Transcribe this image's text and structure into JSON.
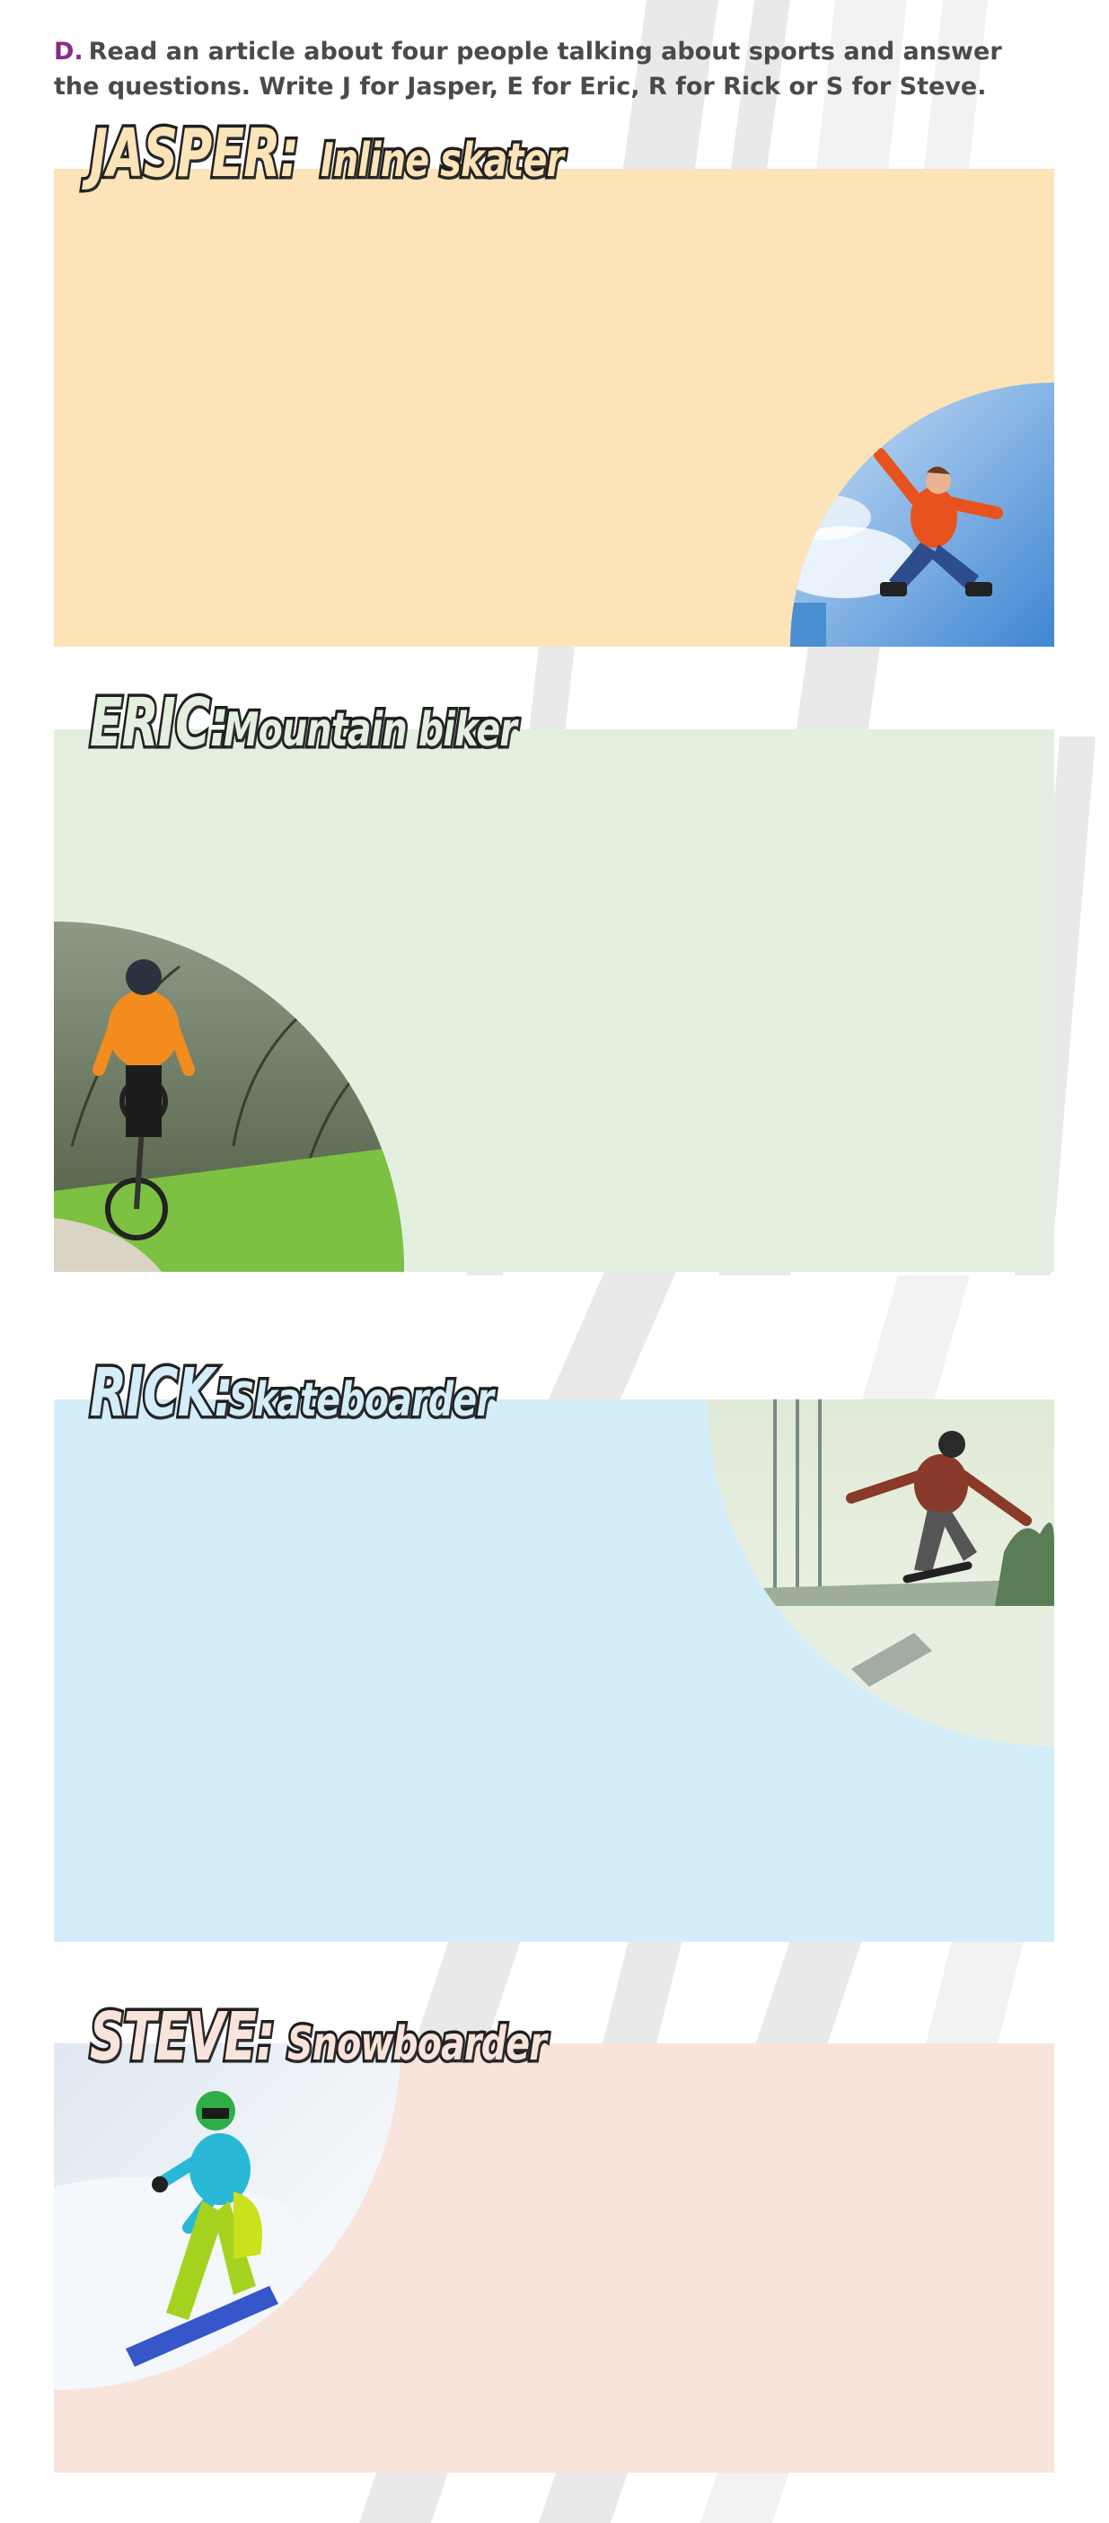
{
  "instruction": {
    "letter": "D.",
    "text": "Read an article about four people talking about sports and answer the questions. Write J for Jasper, E for Eric, R for Rick or S for Steve."
  },
  "people": [
    {
      "name": "JASPER:",
      "role": "Inline skater",
      "color": "#fde4b8",
      "photo": "inline-skater-jumping"
    },
    {
      "name": "ERIC:",
      "role": "Mountain biker",
      "color": "#e3f0df",
      "photo": "mountain-biker-on-trail"
    },
    {
      "name": "RICK:",
      "role": "Skateboarder",
      "color": "#d3edf9",
      "photo": "skateboarder-jumping"
    },
    {
      "name": "STEVE:",
      "role": "Snowboarder",
      "color": "#f8e4db",
      "photo": "snowboarder-on-slope"
    }
  ]
}
